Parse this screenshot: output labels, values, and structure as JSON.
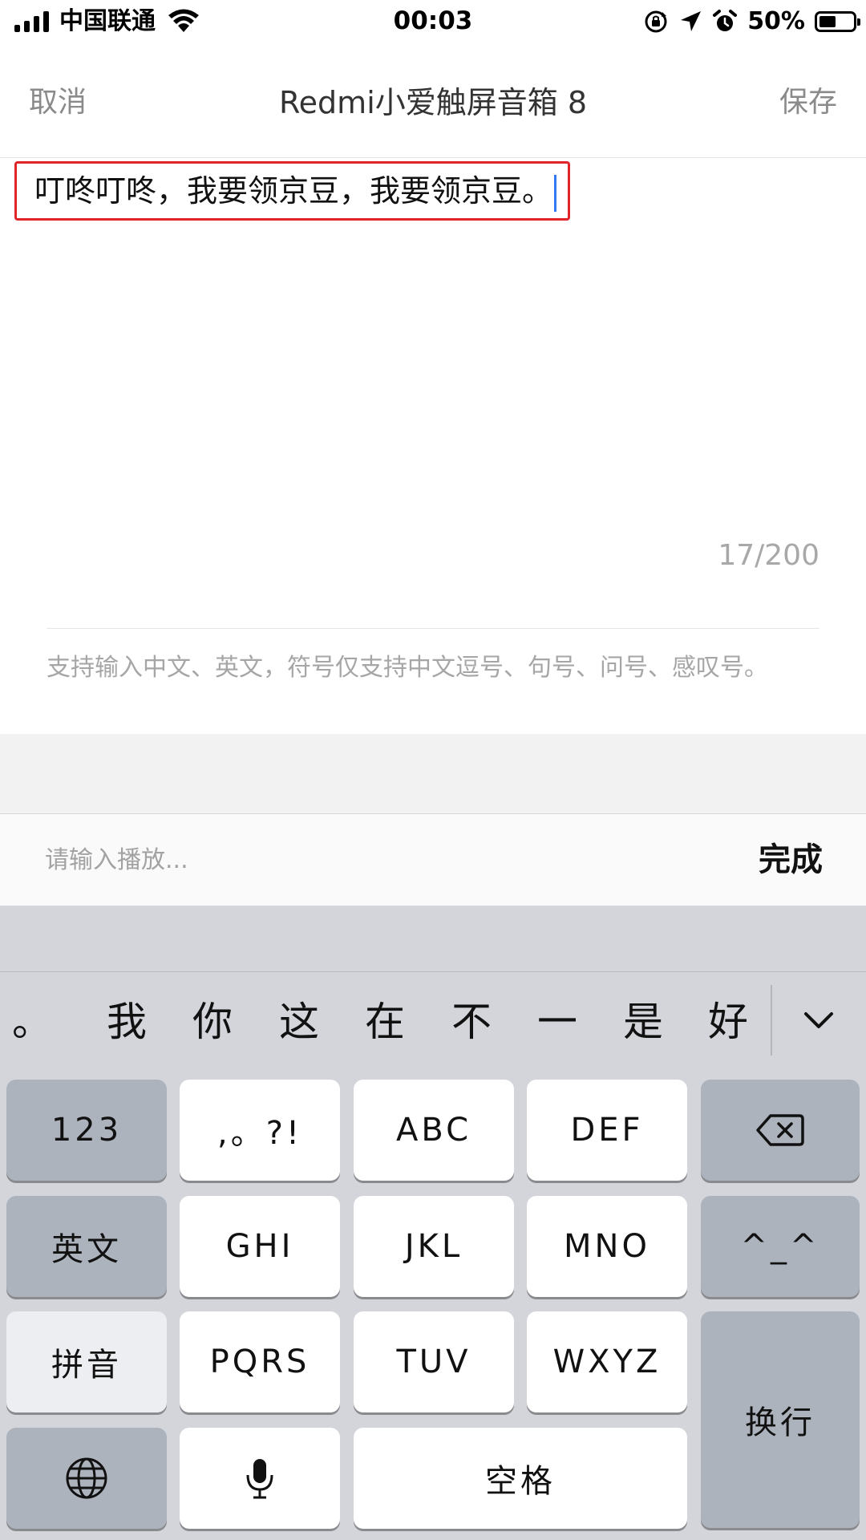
{
  "status_bar": {
    "carrier": "中国联通",
    "time": "00:03",
    "battery": "50%",
    "icons": [
      "signal-icon",
      "wifi-icon",
      "orientation-lock-icon",
      "location-icon",
      "alarm-icon",
      "battery-icon"
    ]
  },
  "nav": {
    "cancel": "取消",
    "title": "Redmi小爱触屏音箱 8",
    "save": "保存"
  },
  "editor": {
    "value": "叮咚叮咚，我要领京豆，我要领京豆。",
    "char_count": "17/200",
    "hint": "支持输入中文、英文，符号仅支持中文逗号、句号、问号、感叹号。"
  },
  "accessory": {
    "placeholder": "请输入播放...",
    "done": "完成"
  },
  "keyboard": {
    "candidates": [
      "。",
      "我",
      "你",
      "这",
      "在",
      "不",
      "一",
      "是",
      "好"
    ],
    "keys": {
      "num": "123",
      "punct": ",。?!",
      "abc": "ABC",
      "def": "DEF",
      "english": "英文",
      "ghi": "GHI",
      "jkl": "JKL",
      "mno": "MNO",
      "emoticon": "^_^",
      "pinyin": "拼音",
      "pqrs": "PQRS",
      "tuv": "TUV",
      "wxyz": "WXYZ",
      "enter": "换行",
      "space": "空格"
    }
  },
  "colors": {
    "highlight_border": "#e0242a",
    "caret": "#3478f6",
    "keyboard_bg": "#d3d5db",
    "function_key": "#adb3bd"
  }
}
